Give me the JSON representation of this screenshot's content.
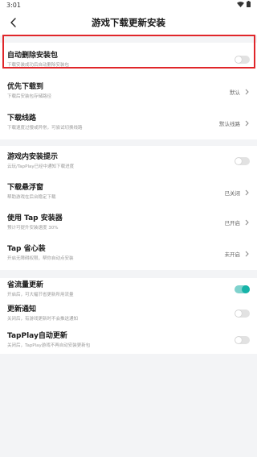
{
  "status": {
    "time": "3:01"
  },
  "header": {
    "title": "游戏下载更新安装"
  },
  "group1": [
    {
      "title": "自动删除安装包",
      "subtitle": "下载安装成功后自动删除安装包",
      "type": "toggle",
      "on": false
    },
    {
      "title": "优先下载到",
      "subtitle": "下载后安装包存储路径",
      "type": "nav",
      "value": "默认"
    },
    {
      "title": "下载线路",
      "subtitle": "下载速度过慢或异常，可尝试切换线路",
      "type": "nav",
      "value": "默认线路"
    }
  ],
  "group2": [
    {
      "title": "游戏内安装提示",
      "subtitle": "云玩/TapPlay已经中通知下载进度",
      "type": "toggle",
      "on": false
    },
    {
      "title": "下载悬浮窗",
      "subtitle": "帮助游戏在后台稳定下载",
      "type": "nav",
      "value": "已关闭"
    },
    {
      "title": "使用 Tap 安装器",
      "subtitle": "预计可提升安装速度 30%",
      "type": "nav",
      "value": "已开启"
    },
    {
      "title": "Tap 省心装",
      "subtitle": "开启无障碍权限，帮你自动点安装",
      "type": "nav",
      "value": "未开启"
    }
  ],
  "group3": [
    {
      "title": "省流量更新",
      "subtitle": "开启后，可大幅节省更新所用流量",
      "type": "toggle",
      "on": true
    },
    {
      "title": "更新通知",
      "subtitle": "关闭后，有游戏更新时不会推送通知",
      "type": "toggle",
      "on": false
    },
    {
      "title": "TapPlay自动更新",
      "subtitle": "关闭后，TapPlay游戏不再自动安装更新包",
      "type": "toggle",
      "on": false
    }
  ],
  "colors": {
    "accent": "#16b3a8",
    "highlight": "#e0262a"
  }
}
